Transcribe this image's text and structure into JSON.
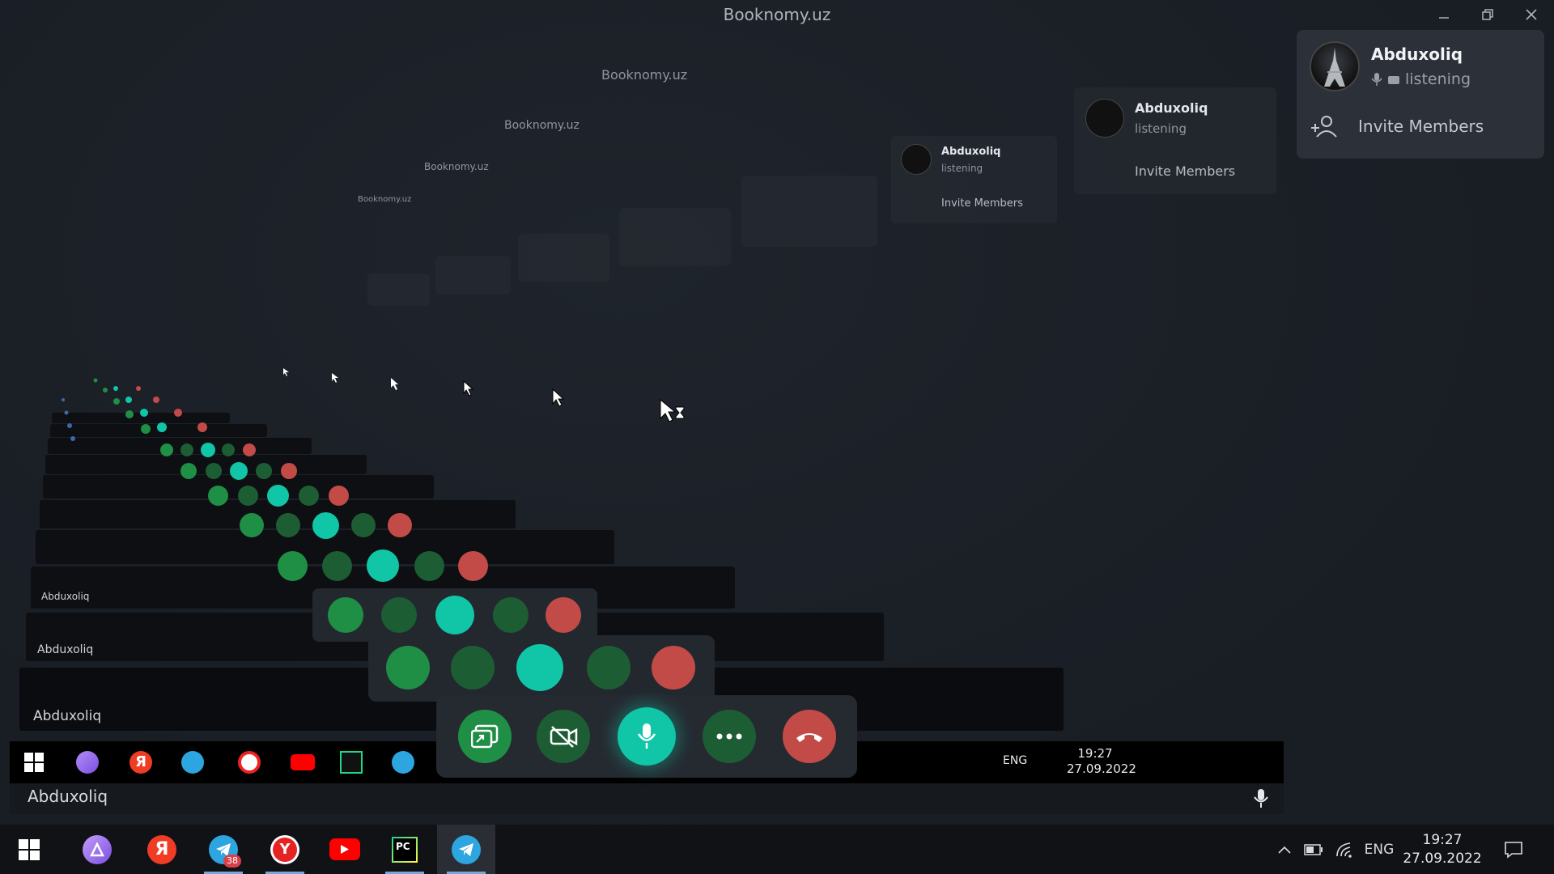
{
  "window": {
    "title": "Booknomy.uz",
    "minimize_icon": "minimize-icon",
    "maximize_icon": "restore-icon",
    "close_icon": "close-icon"
  },
  "participants": {
    "member_name": "Abduxoliq",
    "member_status": "listening",
    "invite_label": "Invite Members"
  },
  "call_controls": {
    "buttons": [
      "screen-share",
      "video-off",
      "microphone",
      "more",
      "end-call"
    ]
  },
  "inner_footer": {
    "speaker_name": "Abduxoliq"
  },
  "taskbar": {
    "apps": [
      {
        "name": "start",
        "icon": "windows-icon"
      },
      {
        "name": "alice",
        "icon": "alice-icon"
      },
      {
        "name": "yandex",
        "icon": "yandex-icon"
      },
      {
        "name": "telegram-badge",
        "icon": "telegram-icon",
        "badge": "38"
      },
      {
        "name": "yandex-browser",
        "icon": "yandex-browser-icon"
      },
      {
        "name": "youtube",
        "icon": "youtube-icon"
      },
      {
        "name": "pycharm",
        "icon": "pycharm-icon",
        "label": "PC"
      },
      {
        "name": "telegram",
        "icon": "telegram-icon"
      }
    ],
    "tray": {
      "language": "ENG",
      "time": "19:27",
      "date": "27.09.2022"
    }
  },
  "colors": {
    "background": "#1a1e25",
    "panel": "#2b3039",
    "accent_green": "#1e8f45",
    "mic_teal": "#10c6a7",
    "end_red": "#c24b47"
  }
}
